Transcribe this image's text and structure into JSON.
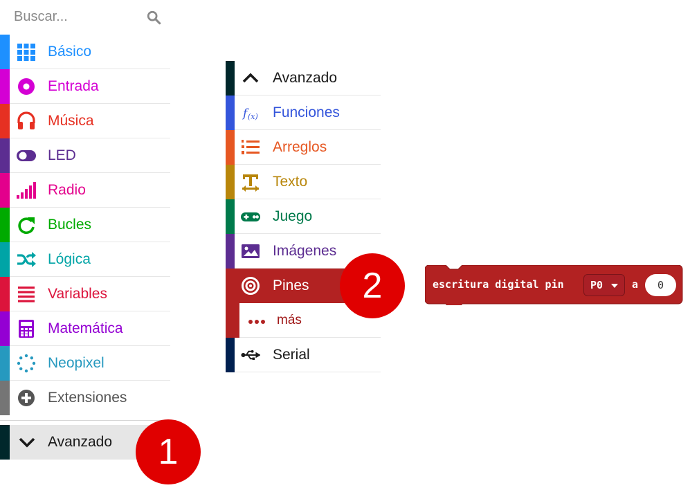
{
  "search": {
    "placeholder": "Buscar..."
  },
  "categories": [
    {
      "label": "Básico",
      "color": "#1e90ff",
      "icon": "grid-icon"
    },
    {
      "label": "Entrada",
      "color": "#d400d4",
      "icon": "target-icon"
    },
    {
      "label": "Música",
      "color": "#e63022",
      "icon": "headphones-icon"
    },
    {
      "label": "LED",
      "color": "#5c2d91",
      "icon": "toggle-icon"
    },
    {
      "label": "Radio",
      "color": "#e3008c",
      "icon": "signal-bars-icon"
    },
    {
      "label": "Bucles",
      "color": "#00aa00",
      "icon": "refresh-icon"
    },
    {
      "label": "Lógica",
      "color": "#00a4a6",
      "icon": "shuffle-icon"
    },
    {
      "label": "Variables",
      "color": "#dc143c",
      "icon": "list-lines-icon"
    },
    {
      "label": "Matemática",
      "color": "#9400d3",
      "icon": "calculator-icon"
    },
    {
      "label": "Neopixel",
      "color": "#2699bf",
      "icon": "dots-ring-icon"
    },
    {
      "label": "Extensiones",
      "color": "#757575",
      "icon": "plus-circle-icon"
    }
  ],
  "advanced": {
    "label": "Avanzado",
    "color": "#00272b"
  },
  "advanced_menu": [
    {
      "label": "Avanzado",
      "color": "#00272b",
      "icon": "chevron-up-icon"
    },
    {
      "label": "Funciones",
      "color": "#3455db",
      "icon": "function-icon"
    },
    {
      "label": "Arreglos",
      "color": "#e65722",
      "icon": "numbered-list-icon"
    },
    {
      "label": "Texto",
      "color": "#b8860b",
      "icon": "text-icon"
    },
    {
      "label": "Juego",
      "color": "#007a4b",
      "icon": "gamepad-icon"
    },
    {
      "label": "Imágenes",
      "color": "#5c2d91",
      "icon": "image-icon"
    },
    {
      "label": "Pines",
      "color": "#b22222",
      "icon": "bullseye-icon"
    },
    {
      "label": "más",
      "color": "#b22222",
      "icon": "ellipsis-icon"
    },
    {
      "label": "Serial",
      "color": "#002050",
      "icon": "usb-icon"
    }
  ],
  "badges": {
    "one": "1",
    "two": "2"
  },
  "block": {
    "text": "escritura digital pin",
    "pin_value": "P0",
    "connector": "a",
    "value": "0",
    "color": "#b22222"
  }
}
